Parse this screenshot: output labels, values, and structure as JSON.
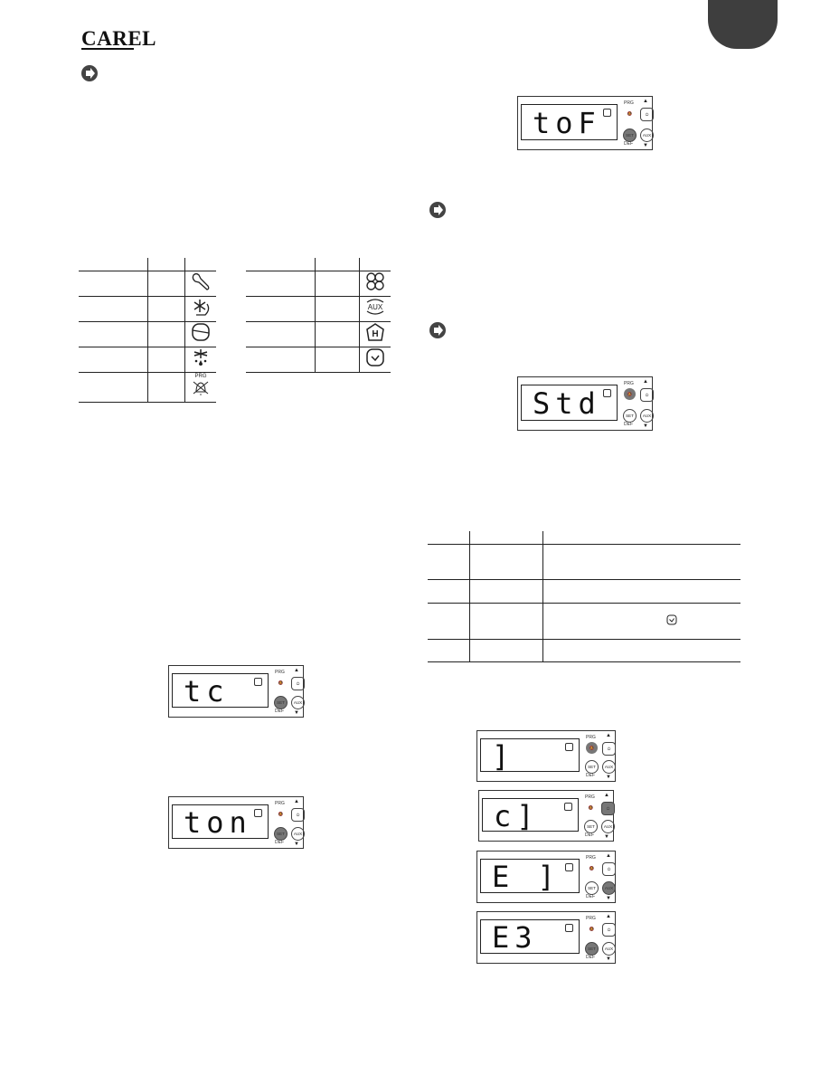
{
  "header": {
    "brand": "CAREL",
    "chapter_tab_color": "#3e3e3e"
  },
  "left": {
    "icon_table_1": {
      "rows": [
        {
          "label": "",
          "code": "",
          "icon": "wrench-icon"
        },
        {
          "label": "",
          "code": "",
          "icon": "snowflake-cycle-icon"
        },
        {
          "label": "",
          "code": "",
          "icon": "compressor-icon"
        },
        {
          "label": "",
          "code": "",
          "icon": "defrost-drip-icon"
        },
        {
          "label": "",
          "code": "",
          "icon": "alarm-bell-muted-icon",
          "icon_text": "PRG"
        }
      ]
    },
    "icon_table_2": {
      "rows": [
        {
          "label": "",
          "code": "",
          "icon": "fan-icon"
        },
        {
          "label": "",
          "code": "",
          "icon": "aux-icon",
          "icon_text": "AUX"
        },
        {
          "label": "",
          "code": "",
          "icon": "hot-h-icon",
          "icon_text": "H"
        },
        {
          "label": "",
          "code": "",
          "icon": "clock-icon"
        }
      ]
    },
    "displays": [
      {
        "text": "tc",
        "highlight": "set"
      },
      {
        "text": "ton",
        "highlight": "set"
      }
    ]
  },
  "right": {
    "displays": [
      {
        "text": "toF",
        "highlight": "set"
      },
      {
        "text": "Std",
        "highlight": "prg"
      }
    ],
    "table": {
      "rows": [
        {
          "c1": "",
          "c2": "",
          "c3": ""
        },
        {
          "c1": "",
          "c2": "",
          "c3": ""
        },
        {
          "c1": "",
          "c2": "",
          "c3": "",
          "icon": "clock-icon"
        },
        {
          "c1": "",
          "c2": "",
          "c3": ""
        }
      ]
    },
    "sequence_displays": [
      {
        "text": "  ]",
        "highlight": "prg"
      },
      {
        "text": " c]",
        "highlight": "power"
      },
      {
        "text": "E ]",
        "highlight": "aux"
      },
      {
        "text": "E3",
        "highlight": "set"
      }
    ]
  },
  "display_labels": {
    "prg": "PRG",
    "set": "SET",
    "aux": "AUX",
    "def": "DEF",
    "up": "▲",
    "down": "▼"
  }
}
